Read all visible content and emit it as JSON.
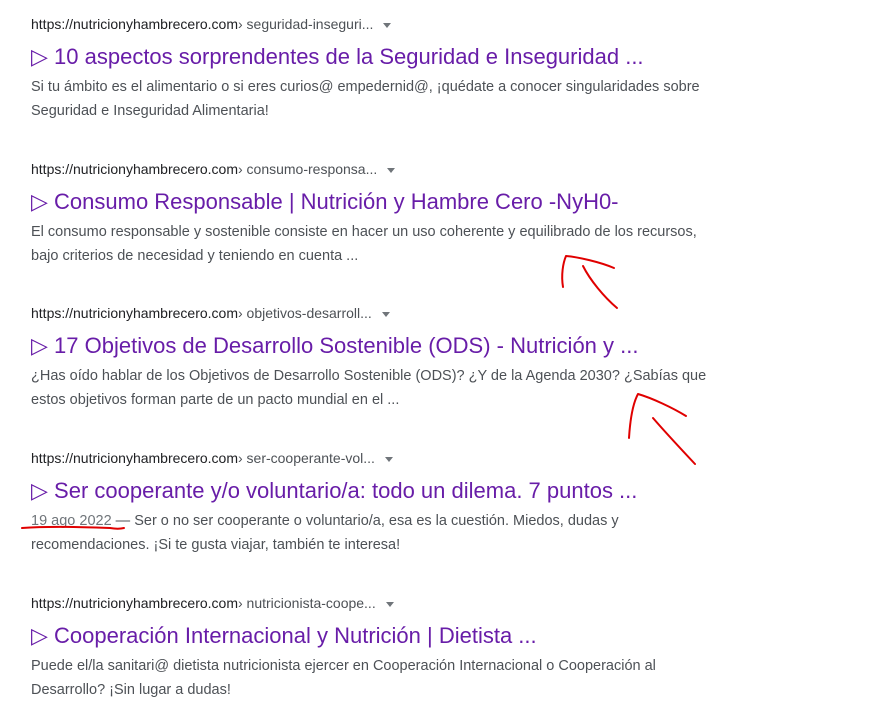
{
  "results": [
    {
      "domain": "https://nutricionyhambrecero.com",
      "path": " › seguridad-inseguri...",
      "title": "▷ 10 aspectos sorprendentes de la Seguridad e Inseguridad ...",
      "date": "",
      "snippet": "Si tu ámbito es el alimentario o si eres curios@ empedernid@, ¡quédate a conocer singularidades sobre Seguridad e Inseguridad Alimentaria!"
    },
    {
      "domain": "https://nutricionyhambrecero.com",
      "path": " › consumo-responsa...",
      "title": "▷ Consumo Responsable | Nutrición y Hambre Cero -NyH0-",
      "date": "",
      "snippet": "El consumo responsable y sostenible consiste en hacer un uso coherente y equilibrado de los recursos, bajo criterios de necesidad y teniendo en cuenta ..."
    },
    {
      "domain": "https://nutricionyhambrecero.com",
      "path": " › objetivos-desarroll...",
      "title": "▷ 17 Objetivos de Desarrollo Sostenible (ODS) - Nutrición y ...",
      "date": "",
      "snippet": "¿Has oído hablar de los Objetivos de Desarrollo Sostenible (ODS)? ¿Y de la Agenda 2030? ¿Sabías que estos objetivos forman parte de un pacto mundial en el ..."
    },
    {
      "domain": "https://nutricionyhambrecero.com",
      "path": " › ser-cooperante-vol...",
      "title": "▷ Ser cooperante y/o voluntario/a: todo un dilema. 7 puntos ...",
      "date": "19 ago 2022",
      "date_sep": " — ",
      "snippet": "Ser o no ser cooperante o voluntario/a, esa es la cuestión. Miedos, dudas y recomendaciones. ¡Si te gusta viajar, también te interesa!"
    },
    {
      "domain": "https://nutricionyhambrecero.com",
      "path": " › nutricionista-coope...",
      "title": "▷ Cooperación Internacional y Nutrición | Dietista ...",
      "date": "",
      "snippet": "Puede el/la sanitari@ dietista nutricionista ejercer en Cooperación Internacional o Cooperación al Desarrollo? ¡Sin lugar a dudas!"
    }
  ],
  "colors": {
    "title": "#681da8",
    "snippet": "#4d5156",
    "annotation": "#e00000"
  }
}
